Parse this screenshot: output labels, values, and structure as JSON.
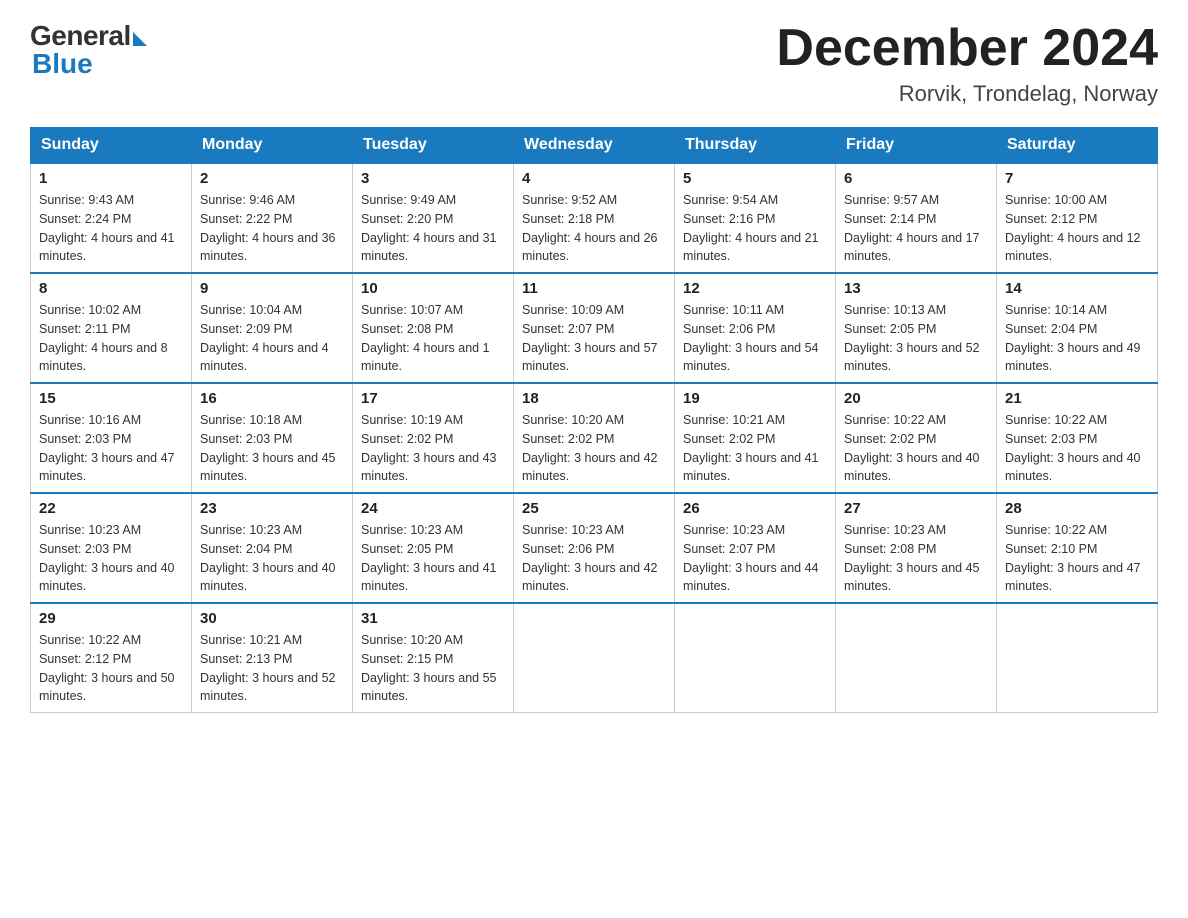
{
  "logo": {
    "general": "General",
    "blue": "Blue"
  },
  "title": {
    "month": "December 2024",
    "location": "Rorvik, Trondelag, Norway"
  },
  "days_of_week": [
    "Sunday",
    "Monday",
    "Tuesday",
    "Wednesday",
    "Thursday",
    "Friday",
    "Saturday"
  ],
  "weeks": [
    [
      {
        "day": "1",
        "sunrise": "9:43 AM",
        "sunset": "2:24 PM",
        "daylight": "4 hours and 41 minutes."
      },
      {
        "day": "2",
        "sunrise": "9:46 AM",
        "sunset": "2:22 PM",
        "daylight": "4 hours and 36 minutes."
      },
      {
        "day": "3",
        "sunrise": "9:49 AM",
        "sunset": "2:20 PM",
        "daylight": "4 hours and 31 minutes."
      },
      {
        "day": "4",
        "sunrise": "9:52 AM",
        "sunset": "2:18 PM",
        "daylight": "4 hours and 26 minutes."
      },
      {
        "day": "5",
        "sunrise": "9:54 AM",
        "sunset": "2:16 PM",
        "daylight": "4 hours and 21 minutes."
      },
      {
        "day": "6",
        "sunrise": "9:57 AM",
        "sunset": "2:14 PM",
        "daylight": "4 hours and 17 minutes."
      },
      {
        "day": "7",
        "sunrise": "10:00 AM",
        "sunset": "2:12 PM",
        "daylight": "4 hours and 12 minutes."
      }
    ],
    [
      {
        "day": "8",
        "sunrise": "10:02 AM",
        "sunset": "2:11 PM",
        "daylight": "4 hours and 8 minutes."
      },
      {
        "day": "9",
        "sunrise": "10:04 AM",
        "sunset": "2:09 PM",
        "daylight": "4 hours and 4 minutes."
      },
      {
        "day": "10",
        "sunrise": "10:07 AM",
        "sunset": "2:08 PM",
        "daylight": "4 hours and 1 minute."
      },
      {
        "day": "11",
        "sunrise": "10:09 AM",
        "sunset": "2:07 PM",
        "daylight": "3 hours and 57 minutes."
      },
      {
        "day": "12",
        "sunrise": "10:11 AM",
        "sunset": "2:06 PM",
        "daylight": "3 hours and 54 minutes."
      },
      {
        "day": "13",
        "sunrise": "10:13 AM",
        "sunset": "2:05 PM",
        "daylight": "3 hours and 52 minutes."
      },
      {
        "day": "14",
        "sunrise": "10:14 AM",
        "sunset": "2:04 PM",
        "daylight": "3 hours and 49 minutes."
      }
    ],
    [
      {
        "day": "15",
        "sunrise": "10:16 AM",
        "sunset": "2:03 PM",
        "daylight": "3 hours and 47 minutes."
      },
      {
        "day": "16",
        "sunrise": "10:18 AM",
        "sunset": "2:03 PM",
        "daylight": "3 hours and 45 minutes."
      },
      {
        "day": "17",
        "sunrise": "10:19 AM",
        "sunset": "2:02 PM",
        "daylight": "3 hours and 43 minutes."
      },
      {
        "day": "18",
        "sunrise": "10:20 AM",
        "sunset": "2:02 PM",
        "daylight": "3 hours and 42 minutes."
      },
      {
        "day": "19",
        "sunrise": "10:21 AM",
        "sunset": "2:02 PM",
        "daylight": "3 hours and 41 minutes."
      },
      {
        "day": "20",
        "sunrise": "10:22 AM",
        "sunset": "2:02 PM",
        "daylight": "3 hours and 40 minutes."
      },
      {
        "day": "21",
        "sunrise": "10:22 AM",
        "sunset": "2:03 PM",
        "daylight": "3 hours and 40 minutes."
      }
    ],
    [
      {
        "day": "22",
        "sunrise": "10:23 AM",
        "sunset": "2:03 PM",
        "daylight": "3 hours and 40 minutes."
      },
      {
        "day": "23",
        "sunrise": "10:23 AM",
        "sunset": "2:04 PM",
        "daylight": "3 hours and 40 minutes."
      },
      {
        "day": "24",
        "sunrise": "10:23 AM",
        "sunset": "2:05 PM",
        "daylight": "3 hours and 41 minutes."
      },
      {
        "day": "25",
        "sunrise": "10:23 AM",
        "sunset": "2:06 PM",
        "daylight": "3 hours and 42 minutes."
      },
      {
        "day": "26",
        "sunrise": "10:23 AM",
        "sunset": "2:07 PM",
        "daylight": "3 hours and 44 minutes."
      },
      {
        "day": "27",
        "sunrise": "10:23 AM",
        "sunset": "2:08 PM",
        "daylight": "3 hours and 45 minutes."
      },
      {
        "day": "28",
        "sunrise": "10:22 AM",
        "sunset": "2:10 PM",
        "daylight": "3 hours and 47 minutes."
      }
    ],
    [
      {
        "day": "29",
        "sunrise": "10:22 AM",
        "sunset": "2:12 PM",
        "daylight": "3 hours and 50 minutes."
      },
      {
        "day": "30",
        "sunrise": "10:21 AM",
        "sunset": "2:13 PM",
        "daylight": "3 hours and 52 minutes."
      },
      {
        "day": "31",
        "sunrise": "10:20 AM",
        "sunset": "2:15 PM",
        "daylight": "3 hours and 55 minutes."
      },
      null,
      null,
      null,
      null
    ]
  ],
  "labels": {
    "sunrise": "Sunrise:",
    "sunset": "Sunset:",
    "daylight": "Daylight:"
  }
}
